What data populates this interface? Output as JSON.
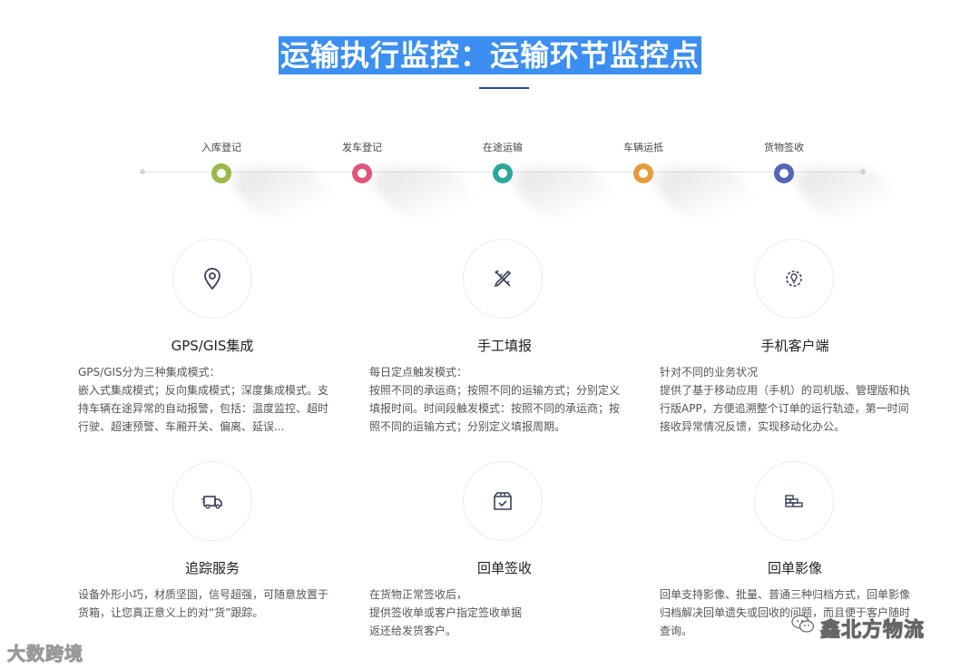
{
  "header": {
    "title": "运输执行监控：运输环节监控点"
  },
  "timeline": {
    "steps": [
      {
        "label": "入库登记",
        "color": "#9bb84a"
      },
      {
        "label": "发车登记",
        "color": "#e0567a"
      },
      {
        "label": "在途运输",
        "color": "#2aa89a"
      },
      {
        "label": "车辆运抵",
        "color": "#e89a3c"
      },
      {
        "label": "货物签收",
        "color": "#5565b8"
      }
    ]
  },
  "features": [
    {
      "icon": "location-pin-icon",
      "title": "GPS/GIS集成",
      "lines": [
        "GPS/GIS分为三种集成模式：",
        "嵌入式集成模式；反向集成模式；深度集成模式。支",
        "持车辆在途异常的自动报警，包括：温度监控、超时",
        "行驶、超速预警、车厢开关、偏离、延误..."
      ]
    },
    {
      "icon": "pencil-ruler-icon",
      "title": "手工填报",
      "lines": [
        "每日定点触发模式：",
        "按照不同的承运商；按照不同的运输方式；分别定义",
        "填报时间。时间段触发模式：按照不同的承运商；按",
        "照不同的运输方式；分别定义填报周期。"
      ]
    },
    {
      "icon": "gear-bulb-icon",
      "title": "手机客户端",
      "lines": [
        "针对不同的业务状况",
        "提供了基于移动应用（手机）的司机版、管理版和执",
        "行版APP，方便追溯整个订单的运行轨迹，第一时间",
        "接收异常情况反馈，实现移动化办公。"
      ]
    },
    {
      "icon": "delivery-truck-icon",
      "title": "追踪服务",
      "lines": [
        "设备外形小巧，材质坚固，信号超强，可随意放置于",
        "货箱，让您真正意义上的对“货”跟踪。"
      ]
    },
    {
      "icon": "package-check-icon",
      "title": "回单签收",
      "lines": [
        "在货物正常签收后，",
        "提供签收单或客户指定签收单据",
        "返还给发货客户。"
      ]
    },
    {
      "icon": "archive-bricks-icon",
      "title": "回单影像",
      "lines": [
        "回单支持影像、批量、普通三种归档方式，回单影像",
        "归档解决回单遗失或回收的问题，而且便于客户随时",
        "查询。"
      ]
    }
  ],
  "watermarks": {
    "left": "大数跨境",
    "right": "鑫北方物流"
  }
}
